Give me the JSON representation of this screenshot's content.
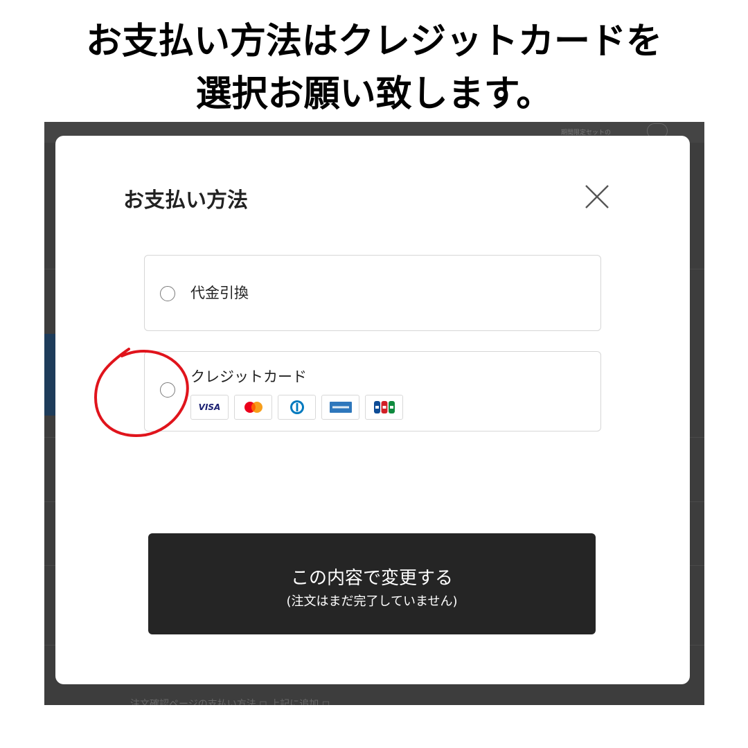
{
  "instruction": {
    "line1": "お支払い方法はクレジットカードを",
    "line2": "選択お願い致します。"
  },
  "background": {
    "topbar_label": "期間限定セットの",
    "footer_text": "注文確認ページの支払い方法 ◻ 上記に追加  ◻"
  },
  "modal": {
    "title": "お支払い方法",
    "close_icon": "close-icon",
    "options": [
      {
        "label": "代金引換",
        "selected": false
      },
      {
        "label": "クレジットカード",
        "selected": false,
        "brands": [
          {
            "name": "visa",
            "text": "VISA"
          },
          {
            "name": "mastercard",
            "text": ""
          },
          {
            "name": "diners",
            "text": ""
          },
          {
            "name": "amex",
            "text": ""
          },
          {
            "name": "jcb",
            "text": ""
          }
        ]
      }
    ],
    "submit": {
      "label": "この内容で変更する",
      "sublabel": "(注文はまだ完了していません)"
    }
  },
  "colors": {
    "overlay": "#3d3d3d",
    "button_bg": "#252525",
    "annotation": "#e0141c",
    "visa": "#1a1f71",
    "mastercard_red": "#eb001b",
    "mastercard_orange": "#f79e1b",
    "diners": "#0079be",
    "amex": "#2e77bc"
  }
}
